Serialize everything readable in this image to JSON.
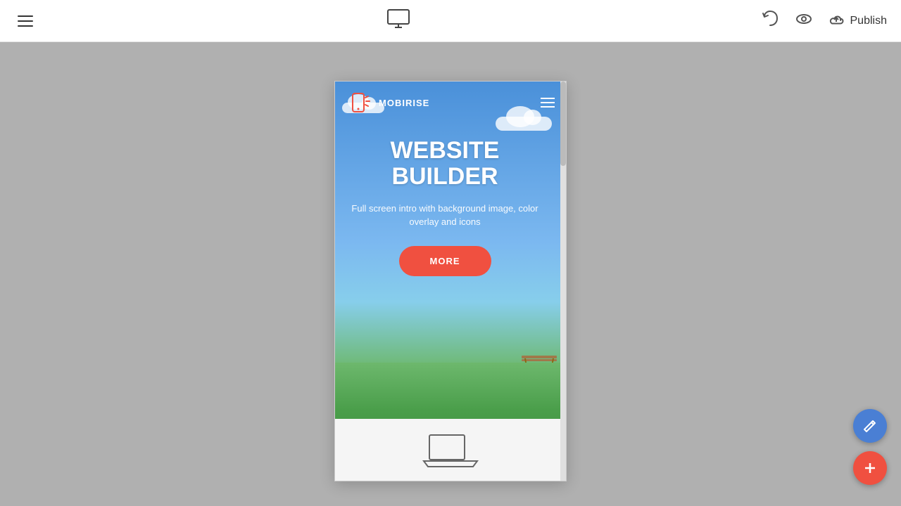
{
  "toolbar": {
    "menu_label": "Menu",
    "publish_label": "Publish",
    "undo_label": "Undo",
    "preview_label": "Preview",
    "publish_icon_label": "cloud-upload-icon"
  },
  "site": {
    "logo_text": "MOBIRISE",
    "hero_title_line1": "WEBSITE",
    "hero_title_line2": "BUILDER",
    "hero_subtitle": "Full screen intro with background image, color overlay and icons",
    "hero_btn_label": "MORE"
  },
  "fabs": {
    "edit_label": "Edit",
    "add_label": "Add"
  },
  "colors": {
    "accent_red": "#f05040",
    "fab_blue": "#4a7fd4",
    "sky_top": "#4a90d9",
    "toolbar_bg": "#ffffff",
    "canvas_bg": "#b0b0b0"
  }
}
